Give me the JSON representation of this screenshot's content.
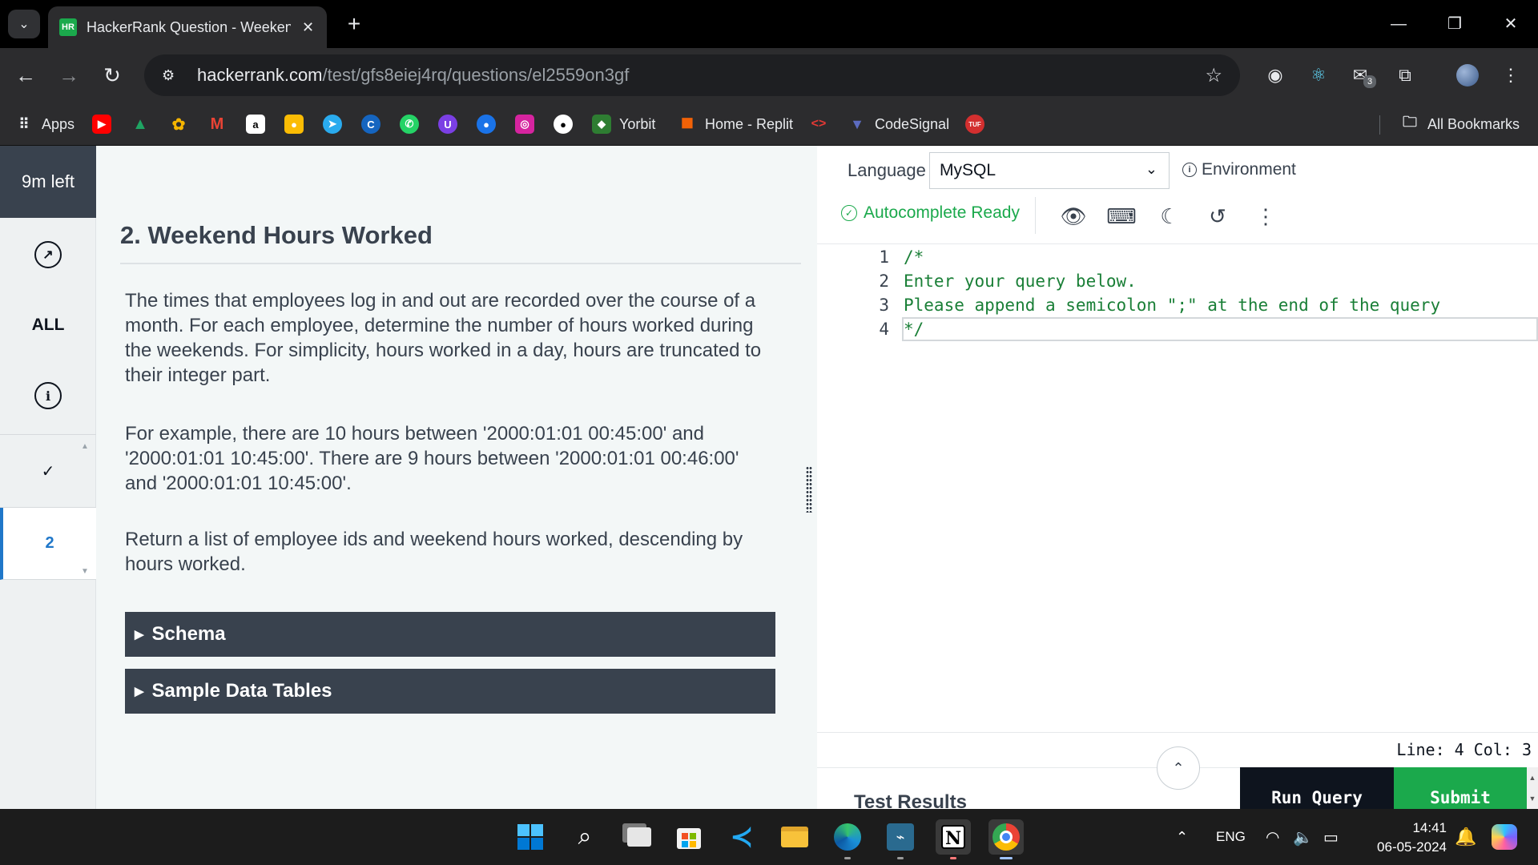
{
  "browser": {
    "tab_title": "HackerRank Question - Weekend Hours Worked",
    "tab_favicon": "HR",
    "new_tab": "+",
    "url_domain": "hackerrank.com",
    "url_path": "/test/gfs8eiej4rq/questions/el2559on3gf",
    "extensions_badge": "3"
  },
  "bookmarks": [
    {
      "label": "Apps",
      "icon": "apps-grid-icon",
      "color": "#e8eaed"
    },
    {
      "label": "",
      "icon": "youtube-icon",
      "color": "#ff0000"
    },
    {
      "label": "",
      "icon": "drive-icon",
      "color": "#1fa463"
    },
    {
      "label": "",
      "icon": "photos-icon",
      "color": "#f4b400"
    },
    {
      "label": "",
      "icon": "gmail-icon",
      "color": "#ea4335"
    },
    {
      "label": "",
      "icon": "amazon-icon",
      "color": "#ffffff"
    },
    {
      "label": "",
      "icon": "keep-icon",
      "color": "#fbbc04"
    },
    {
      "label": "",
      "icon": "telegram-icon",
      "color": "#2aabee"
    },
    {
      "label": "",
      "icon": "c-icon",
      "color": "#1565c0"
    },
    {
      "label": "",
      "icon": "whatsapp-icon",
      "color": "#25d366"
    },
    {
      "label": "",
      "icon": "u-icon",
      "color": "#7b3fe4"
    },
    {
      "label": "",
      "icon": "chat-icon",
      "color": "#1a73e8"
    },
    {
      "label": "",
      "icon": "instagram-icon",
      "color": "#d6249f"
    },
    {
      "label": "",
      "icon": "github-icon",
      "color": "#ffffff"
    },
    {
      "label": "Yorbit",
      "icon": "yorbit-icon",
      "color": "#2e7d32"
    },
    {
      "label": "Home - Replit",
      "icon": "replit-icon",
      "color": "#f26207"
    },
    {
      "label": "",
      "icon": "code-icon",
      "color": "#e53935"
    },
    {
      "label": "CodeSignal",
      "icon": "codesignal-icon",
      "color": "#3f51b5"
    },
    {
      "label": "",
      "icon": "tuf-icon",
      "color": "#d32f2f"
    }
  ],
  "all_bookmarks": "All Bookmarks",
  "rail": {
    "timer": "9m left",
    "all_label": "ALL",
    "questions": [
      {
        "label": "✓",
        "state": "done"
      },
      {
        "label": "2",
        "state": "active"
      }
    ]
  },
  "problem": {
    "title": "2. Weekend Hours Worked",
    "paragraphs": [
      "The times that employees log in and out are recorded over the course of a month. For each employee, determine the number of hours worked during the weekends. For simplicity, hours worked in a day, hours are truncated to their integer part.",
      "For example, there are 10 hours between '2000:01:01 00:45:00' and '2000:01:01 10:45:00'. There are 9 hours between '2000:01:01 00:46:00' and '2000:01:01 10:45:00'.",
      "Return a list of employee ids and weekend hours worked, descending by hours worked."
    ],
    "sections": [
      "Schema",
      "Sample Data Tables"
    ]
  },
  "editor": {
    "language_label": "Language",
    "language_value": "MySQL",
    "environment_label": "Environment",
    "autocomplete": "Autocomplete Ready",
    "lines": [
      {
        "num": "1",
        "text": "/*"
      },
      {
        "num": "2",
        "text": "Enter your query below."
      },
      {
        "num": "3",
        "text": "Please append a semicolon \";\" at the end of the query"
      },
      {
        "num": "4",
        "text": "*/"
      }
    ],
    "status": "Line: 4 Col: 3",
    "test_results": "Test Results",
    "run_label": "Run Query",
    "submit_label": "Submit"
  },
  "taskbar": {
    "language": "ENG",
    "time": "14:41",
    "date": "06-05-2024"
  }
}
